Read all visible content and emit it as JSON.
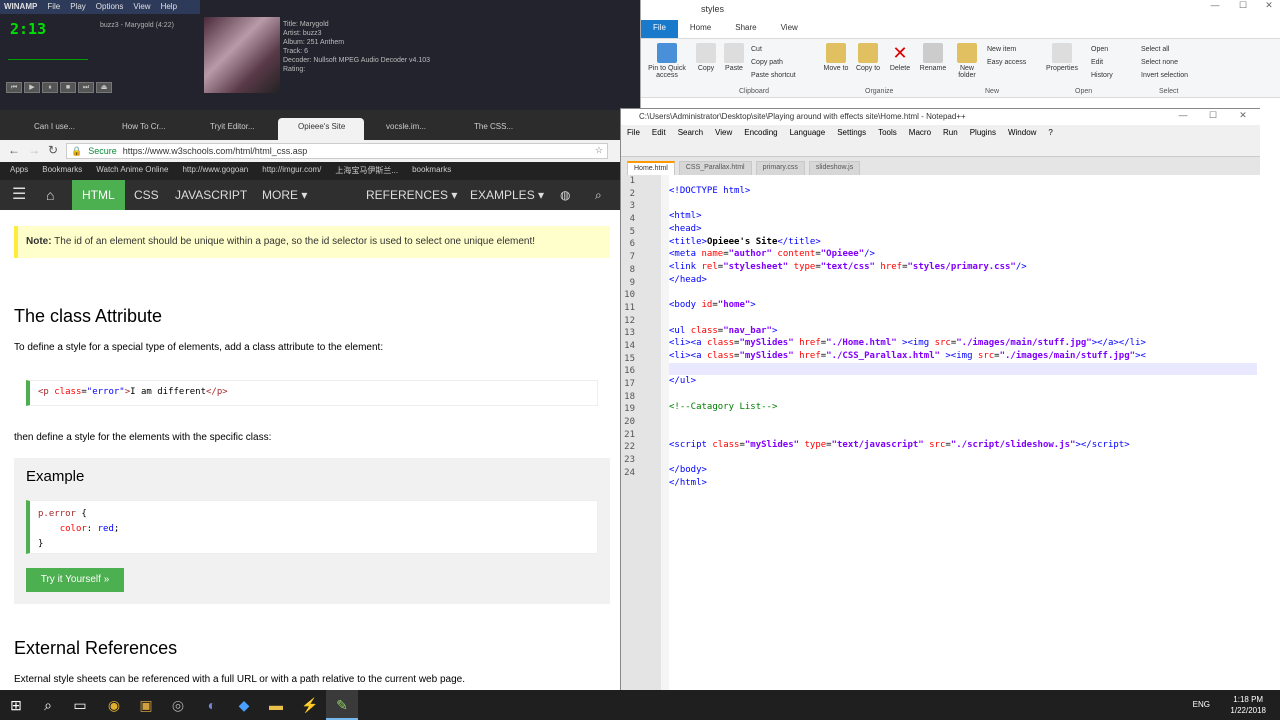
{
  "winamp": {
    "title": "WINAMP",
    "menu": [
      "File",
      "Play",
      "Options",
      "View",
      "Help"
    ],
    "time": "2:13",
    "track": "buzz3 - Marygold (4:22)",
    "info": [
      "Title: Marygold",
      "Artist: buzz3",
      "Album: 251 Anthem",
      "Track: 6",
      "Decoder: Nullsoft MPEG Audio Decoder v4.103",
      "Rating:"
    ]
  },
  "explorer": {
    "title": "styles",
    "tabs": [
      "File",
      "Home",
      "Share",
      "View"
    ],
    "buttons": [
      "Pin to Quick access",
      "Copy",
      "Paste",
      "Cut",
      "Copy path",
      "Paste shortcut",
      "Move to",
      "Copy to",
      "Delete",
      "Rename",
      "New folder",
      "New item",
      "Easy access",
      "Properties",
      "Open",
      "Edit",
      "History",
      "Select all",
      "Select none",
      "Invert selection"
    ],
    "groups": [
      "Clipboard",
      "Organize",
      "New",
      "Open",
      "Select"
    ]
  },
  "chrome": {
    "tabs": [
      "Can I use...",
      "How To Cr...",
      "Tryit Editor...",
      "Opieee's Site",
      "vocsle.im...",
      "The CSS..."
    ],
    "secure": "Secure",
    "url": "https://www.w3schools.com/html/html_css.asp",
    "bookmarks": [
      "Apps",
      "Bookmarks",
      "Watch Anime Online",
      "http://www.gogoan",
      "http://imgur.com/",
      "上海宝马伊斯兰...",
      "bookmarks"
    ]
  },
  "w3": {
    "nav": [
      "HTML",
      "CSS",
      "JAVASCRIPT",
      "MORE ▾",
      "REFERENCES ▾",
      "EXAMPLES ▾"
    ],
    "note_label": "Note:",
    "note_text": " The id of an element should be unique within a page, so the id selector is used to select one unique element!",
    "h_class": "The class Attribute",
    "p1": "To define a style for a special type of elements, add a class attribute to the element:",
    "p2": "then define a style for the elements with the specific class:",
    "example": "Example",
    "tryit": "Try it Yourself »",
    "h_ext": "External References",
    "p3": "External style sheets can be referenced with a full URL or with a path relative to the current web page."
  },
  "npp": {
    "title": "C:\\Users\\Administrator\\Desktop\\site\\Playing around with effects site\\Home.html - Notepad++",
    "menu": [
      "File",
      "Edit",
      "Search",
      "View",
      "Encoding",
      "Language",
      "Settings",
      "Tools",
      "Macro",
      "Run",
      "Plugins",
      "Window",
      "?"
    ],
    "tabs": [
      "Home.html",
      "CSS_Parallax.html",
      "primary.css",
      "slideshow.js"
    ]
  },
  "taskbar": {
    "lang": "ENG",
    "time": "1:18 PM",
    "date": "1/22/2018"
  }
}
